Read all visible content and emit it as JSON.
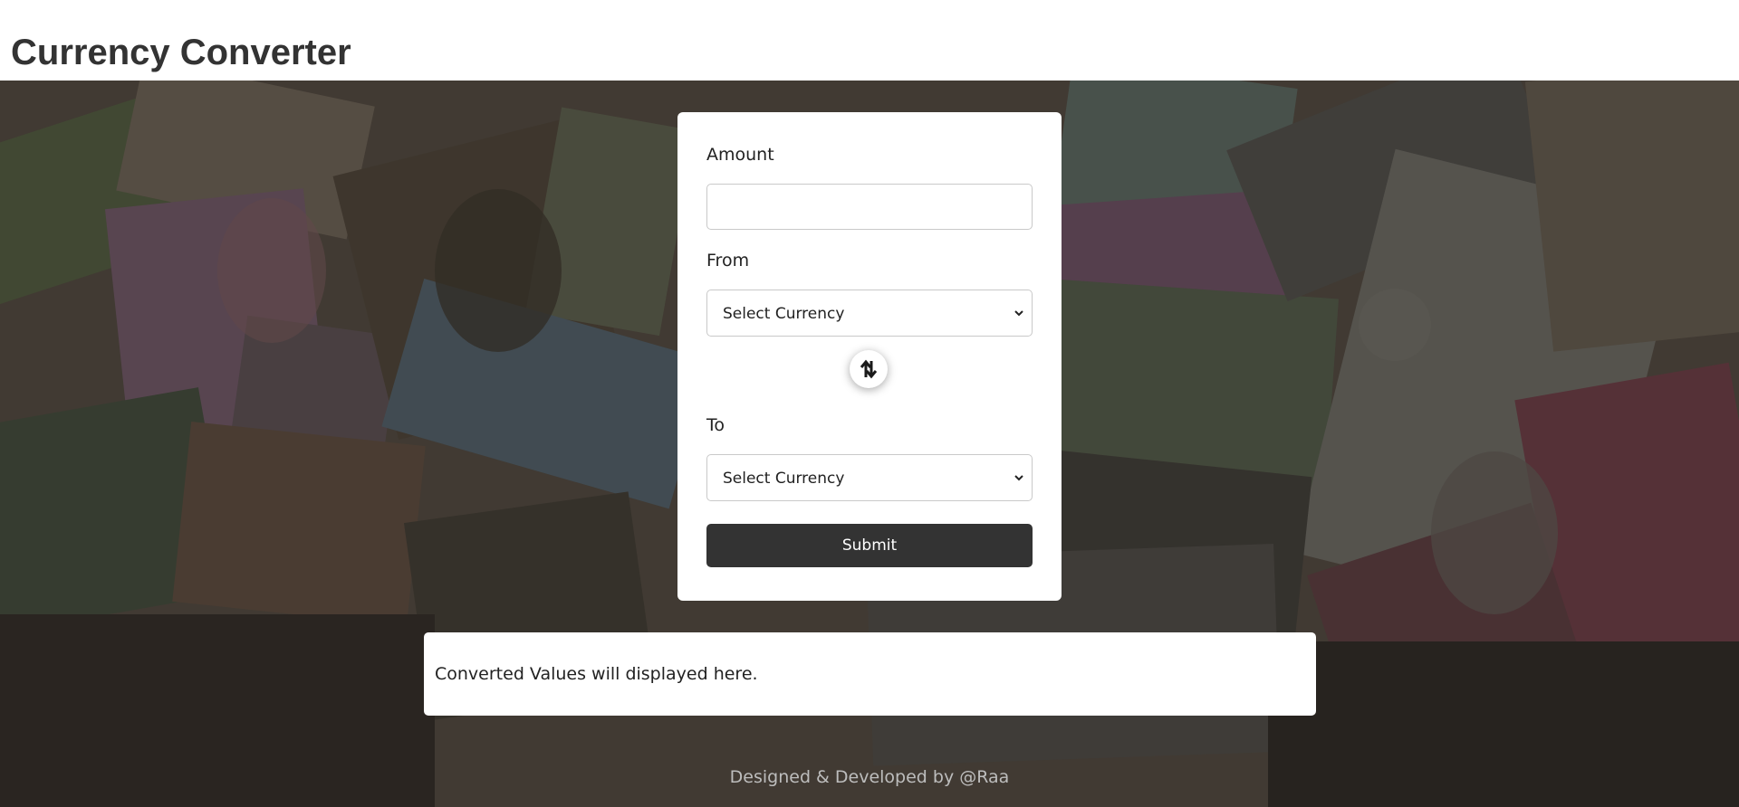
{
  "header": {
    "title": "Currency Converter"
  },
  "form": {
    "amount_label": "Amount",
    "amount_value": "",
    "from_label": "From",
    "from_selected": "Select Currency",
    "to_label": "To",
    "to_selected": "Select Currency",
    "submit_label": "Submit"
  },
  "result": {
    "text": "Converted Values will displayed here."
  },
  "footer": {
    "credit": "Designed & Developed by @Raa"
  },
  "colors": {
    "header_bg": "#ffffff",
    "title_text": "#333333",
    "submit_bg": "#333333",
    "background_overlay": "#463d36"
  },
  "icons": {
    "swap": "swap-vertical-arrows-icon",
    "dropdown": "chevron-down-icon"
  }
}
